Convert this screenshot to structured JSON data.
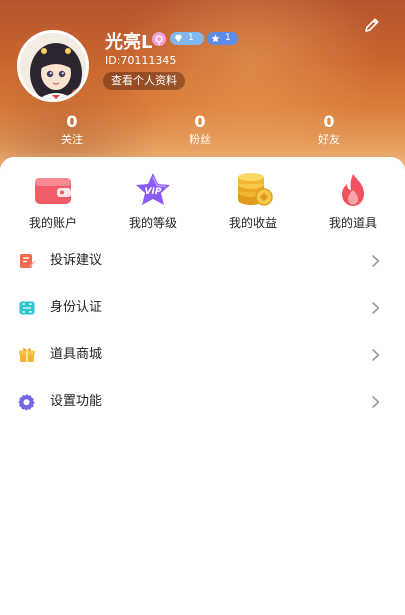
{
  "profile": {
    "username": "光亮L",
    "user_id": "ID:70111345",
    "view_profile_label": "查看个人资料",
    "badges": [
      {
        "icon": "diamond-icon",
        "level": "1",
        "color": "#7fb7ee"
      },
      {
        "icon": "star-icon",
        "level": "1",
        "color": "#5d8de8"
      }
    ]
  },
  "stats": [
    {
      "count": "0",
      "label": "关注"
    },
    {
      "count": "0",
      "label": "粉丝"
    },
    {
      "count": "0",
      "label": "好友"
    }
  ],
  "quick_actions": [
    {
      "label": "我的账户",
      "icon": "wallet-icon",
      "color": "#ef5b66"
    },
    {
      "label": "我的等级",
      "icon": "vip-star-icon",
      "color": "#8b5cf6"
    },
    {
      "label": "我的收益",
      "icon": "coins-icon",
      "color": "#f2b531"
    },
    {
      "label": "我的道具",
      "icon": "flame-icon",
      "color": "#f0525f"
    }
  ],
  "menu": [
    {
      "label": "投诉建议",
      "icon": "complaint-icon",
      "color": "#f06a4f"
    },
    {
      "label": "身份认证",
      "icon": "id-scan-icon",
      "color": "#2cc3c9"
    },
    {
      "label": "道具商城",
      "icon": "gift-box-icon",
      "color": "#f2b531"
    },
    {
      "label": "设置功能",
      "icon": "gear-icon",
      "color": "#7166e8"
    }
  ],
  "theme": {
    "header_gradient": [
      "#b5562e",
      "#f1c08f"
    ],
    "text_primary": "#222222",
    "chevron_color": "#999999"
  }
}
